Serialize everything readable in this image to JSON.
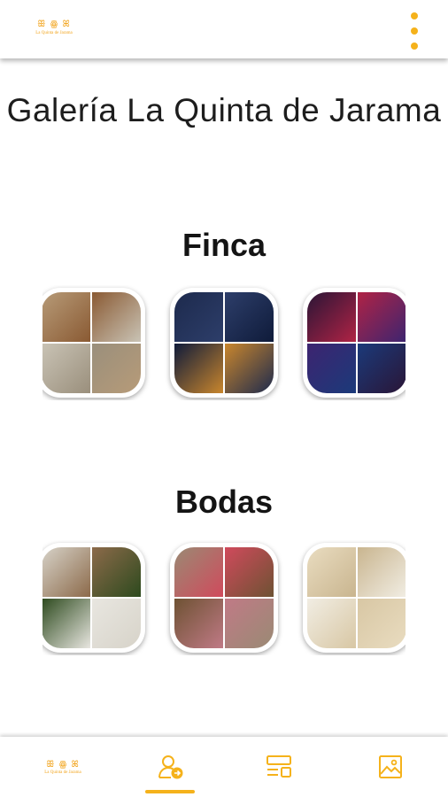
{
  "header": {
    "logo_mark": "ꕥ ꙮ ꕤ",
    "logo_text": "La Quinta de Jarama",
    "menu_icon": "kebab-menu-icon",
    "accent": "#f5b21b"
  },
  "page": {
    "title": "Galería La Quinta de Jarama"
  },
  "sections": [
    {
      "title": "Finca",
      "thumbs": [
        {
          "name": "finca-collage-1",
          "colors": [
            "#b79b78",
            "#8a5a33",
            "#c9c3b5",
            "#9a8f7c"
          ]
        },
        {
          "name": "finca-collage-2",
          "colors": [
            "#1d2a4d",
            "#2d3e6a",
            "#0f1b3a",
            "#c9862d"
          ]
        },
        {
          "name": "finca-collage-3",
          "colors": [
            "#2a1536",
            "#b02345",
            "#3d2470",
            "#1b3a7a"
          ]
        }
      ]
    },
    {
      "title": "Bodas",
      "thumbs": [
        {
          "name": "bodas-collage-1",
          "colors": [
            "#d7d3c9",
            "#8c6a4a",
            "#2d4a1e",
            "#e8e6e0"
          ]
        },
        {
          "name": "bodas-collage-2",
          "colors": [
            "#9a8a74",
            "#d04a5c",
            "#6e5233",
            "#c07a86"
          ]
        },
        {
          "name": "bodas-collage-3",
          "colors": [
            "#e9dcc0",
            "#c9b58f",
            "#f1ede3",
            "#d8c7a4"
          ]
        }
      ]
    }
  ],
  "bottom_nav": {
    "items": [
      {
        "name": "home-logo",
        "icon": "logo-icon"
      },
      {
        "name": "profile",
        "icon": "user-arrow-icon",
        "active": true
      },
      {
        "name": "list",
        "icon": "list-icon"
      },
      {
        "name": "gallery",
        "icon": "image-icon"
      }
    ]
  }
}
